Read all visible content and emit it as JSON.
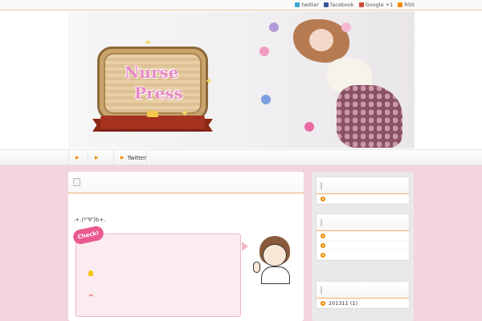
{
  "topbar": {
    "links": [
      {
        "label": "twitter",
        "icon": "twitter-icon",
        "color": "#3fa9d6"
      },
      {
        "label": "facebook",
        "icon": "facebook-icon",
        "color": "#3b5998"
      },
      {
        "label": "Google +1",
        "icon": "google-plus-icon",
        "color": "#d34836"
      },
      {
        "label": "RSS",
        "icon": "rss-icon",
        "color": "#f08a00"
      }
    ]
  },
  "header": {
    "logo_line1": "Nurse",
    "logo_line2": "Press"
  },
  "nav": {
    "items": [
      {
        "label": ""
      },
      {
        "label": ""
      },
      {
        "label": "Twitter"
      }
    ]
  },
  "post": {
    "intro": ".+.(*'∀')b+.",
    "check_label": "Check!",
    "arrow_text": "⇒ ."
  },
  "sidebar": {
    "widgets": [
      {
        "rows": [
          ""
        ]
      },
      {
        "rows": [
          "",
          "",
          ""
        ]
      },
      {
        "rows": [
          "201311 (1)"
        ]
      }
    ]
  },
  "colors": {
    "background": "#f2d4df",
    "accent_orange": "#f08a00",
    "check_pink": "#ea5a8f",
    "logo_pink": "#e78ac4"
  }
}
